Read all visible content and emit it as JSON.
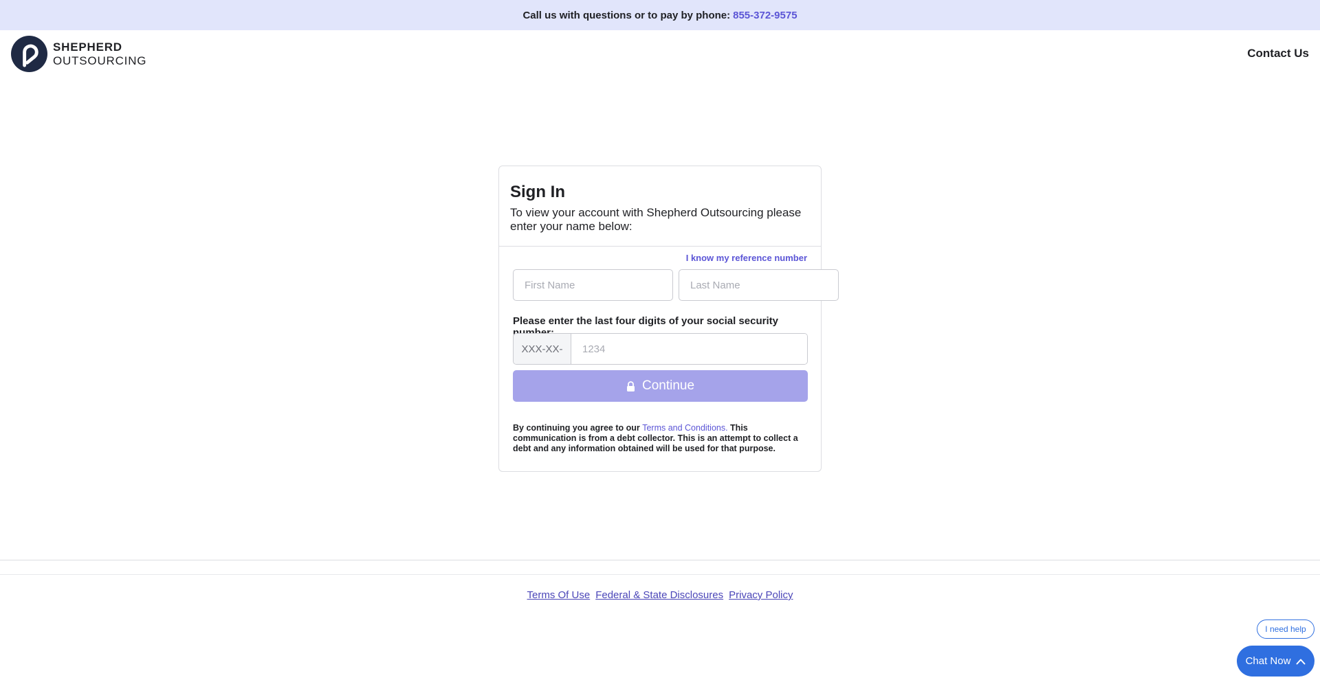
{
  "topbar": {
    "text": "Call us with questions or to pay by phone:",
    "phone": "855-372-9575"
  },
  "header": {
    "logo_line1": "SHEPHERD",
    "logo_line2": "OUTSOURCING",
    "contact_label": "Contact Us"
  },
  "signin": {
    "title": "Sign In",
    "subtitle": "To view your account with Shepherd Outsourcing please enter your name below:",
    "ref_link": "I know my reference number",
    "first_name_placeholder": "First Name",
    "last_name_placeholder": "Last Name",
    "ssn_label": "Please enter the last four digits of your social security number:",
    "ssn_prefix": "XXX-XX-",
    "ssn_placeholder": "1234",
    "continue_label": "Continue",
    "disclaimer_pre": "By continuing you agree to our ",
    "disclaimer_link": "Terms and Conditions.",
    "disclaimer_post": " This communication is from a debt collector. This is an attempt to collect a debt and any information obtained will be used for that purpose."
  },
  "footer": {
    "links": [
      "Terms Of Use",
      "Federal & State Disclosures",
      "Privacy Policy"
    ]
  },
  "chat": {
    "help_label": "I need help",
    "chat_label": "Chat Now"
  },
  "colors": {
    "topbar_bg": "#e1e5fb",
    "accent": "#5b55d6",
    "button_disabled": "#a5a3ea",
    "chat_blue": "#2f6fe0"
  }
}
